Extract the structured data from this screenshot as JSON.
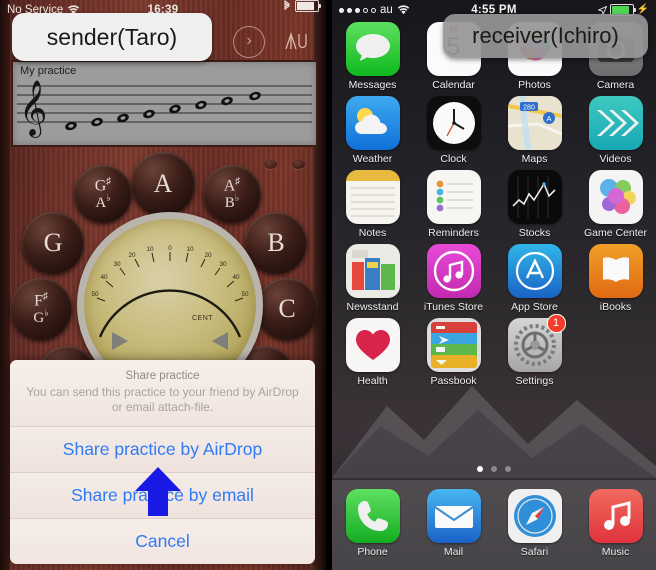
{
  "left_phone": {
    "status_bar": {
      "carrier": "No Service",
      "time": "16:39",
      "wifi_icon": "wifi-icon",
      "bluetooth_icon": "bluetooth-icon",
      "battery_icon": "battery-icon"
    },
    "toolbar": {
      "forward_label": "›",
      "forward_icon": "chevron-right-circle-icon",
      "tuning_fork_icon": "tuning-fork-icon"
    },
    "staff": {
      "title": "My practice",
      "clef": "treble-clef",
      "note_count": 8
    },
    "tuner": {
      "notes": [
        "G♯/A♭",
        "A",
        "A♯/B♭",
        "G",
        "B",
        "F♯/G♭",
        "C"
      ],
      "note_a": "A",
      "note_gs": "G",
      "note_gs_sub": "A",
      "note_as": "A",
      "note_as_sub": "B",
      "note_g": "G",
      "note_b": "B",
      "note_fs": "F",
      "note_fs_sub": "G",
      "note_c": "C",
      "dial_unit": "CENT",
      "dial_ticks": [
        "50",
        "40",
        "30",
        "20",
        "10",
        "0",
        "10",
        "20",
        "30",
        "40",
        "50"
      ]
    },
    "action_sheet": {
      "title": "Share practice",
      "subtitle": "You can send this practice to your friend by AirDrop or email attach-file.",
      "buttons": [
        "Share practice by AirDrop",
        "Share practice by email",
        "Cancel"
      ],
      "airdrop_label": "Share practice by AirDrop",
      "email_label": "Share practice by email",
      "cancel_label": "Cancel",
      "accent_color": "#2f7bf6"
    }
  },
  "right_phone": {
    "status_bar": {
      "carrier": "au",
      "time": "4:55 PM",
      "signal_icon": "signal-dots-icon",
      "wifi_icon": "wifi-icon",
      "battery_icon": "battery-charging-icon",
      "bolt_icon": "charging-bolt-icon"
    },
    "apps": [
      [
        {
          "label": "Messages",
          "icon": "messages-icon"
        },
        {
          "label": "Calendar",
          "icon": "calendar-icon"
        },
        {
          "label": "Photos",
          "icon": "photos-icon"
        },
        {
          "label": "Camera",
          "icon": "camera-icon"
        }
      ],
      [
        {
          "label": "Weather",
          "icon": "weather-icon"
        },
        {
          "label": "Clock",
          "icon": "clock-icon"
        },
        {
          "label": "Maps",
          "icon": "maps-icon"
        },
        {
          "label": "Videos",
          "icon": "videos-icon"
        }
      ],
      [
        {
          "label": "Notes",
          "icon": "notes-icon"
        },
        {
          "label": "Reminders",
          "icon": "reminders-icon"
        },
        {
          "label": "Stocks",
          "icon": "stocks-icon"
        },
        {
          "label": "Game Center",
          "icon": "game-center-icon"
        }
      ],
      [
        {
          "label": "Newsstand",
          "icon": "newsstand-icon"
        },
        {
          "label": "iTunes Store",
          "icon": "itunes-store-icon"
        },
        {
          "label": "App Store",
          "icon": "app-store-icon"
        },
        {
          "label": "iBooks",
          "icon": "ibooks-icon"
        }
      ],
      [
        {
          "label": "Health",
          "icon": "health-icon"
        },
        {
          "label": "Passbook",
          "icon": "passbook-icon"
        },
        {
          "label": "Settings",
          "icon": "settings-icon",
          "badge": "1"
        }
      ]
    ],
    "dock": [
      {
        "label": "Phone",
        "icon": "phone-icon"
      },
      {
        "label": "Mail",
        "icon": "mail-icon"
      },
      {
        "label": "Safari",
        "icon": "safari-icon"
      },
      {
        "label": "Music",
        "icon": "music-icon"
      }
    ],
    "page_dots": {
      "count": 3,
      "active_index": 0
    },
    "settings_badge": "1"
  },
  "annotations": {
    "sender_label": "sender(Taro)",
    "receiver_label": "receiver(Ichiro)",
    "arrow_icon": "up-arrow-annotation",
    "arrow_color": "#1a1ae6"
  }
}
